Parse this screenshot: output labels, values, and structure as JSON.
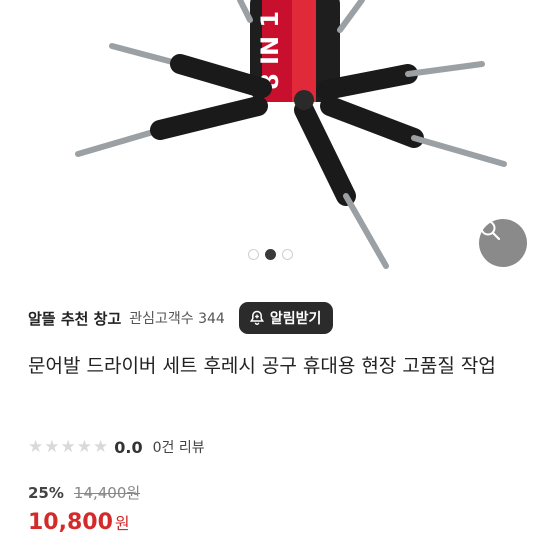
{
  "product_image": {
    "label_text": "8 IN 1",
    "carousel": {
      "count": 3,
      "active_index": 1
    },
    "zoom_icon": "magnifier-icon"
  },
  "store": {
    "name": "알뜰 추천 창고",
    "followers": "관심고객수 344",
    "alarm_button": "알림받기",
    "alarm_icon": "bell-plus-icon"
  },
  "product": {
    "title": "문어발 드라이버 세트 후레시 공구 휴대용 현장 고품질 작업",
    "rating": "0.0",
    "rating_stars": 0,
    "review_count": "0건 리뷰",
    "discount": "25%",
    "original_price": "14,400원",
    "price": "10,800",
    "price_unit": "원"
  },
  "colors": {
    "price": "#d42a2a",
    "alarm_bg": "#2b2b2b",
    "handle_red": "#c8102e"
  }
}
